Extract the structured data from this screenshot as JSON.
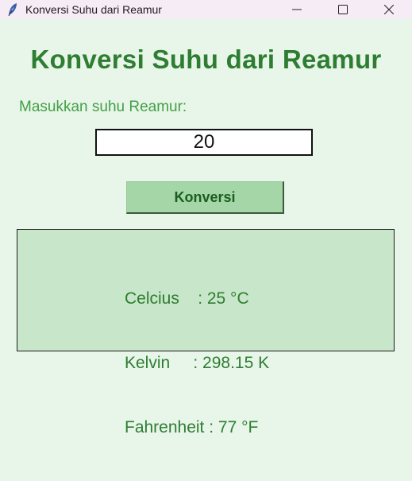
{
  "window": {
    "title": "Konversi Suhu dari Reamur",
    "icons": {
      "app": "feather-icon",
      "minimize": "minimize-icon",
      "maximize": "maximize-icon",
      "close": "close-icon"
    }
  },
  "main": {
    "heading": "Konversi Suhu dari Reamur",
    "input_label": "Masukkan suhu Reamur:",
    "input_value": "20",
    "convert_label": "Konversi",
    "results": {
      "celcius": "Celcius    : 25 °C",
      "kelvin": "Kelvin     : 298.15 K",
      "fahrenheit": "Fahrenheit : 77 °F"
    }
  },
  "colors": {
    "background": "#e8f5e9",
    "heading": "#2e7d32",
    "label": "#43a047",
    "button": "#a5d6a7",
    "result_box": "#c8e6c9"
  }
}
